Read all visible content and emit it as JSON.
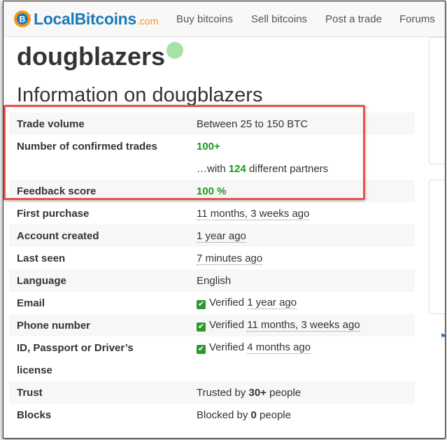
{
  "navbar": {
    "logo_text": "LocalBitcoins",
    "logo_suffix": ".com",
    "links": [
      "Buy bitcoins",
      "Sell bitcoins",
      "Post a trade",
      "Forums"
    ]
  },
  "profile": {
    "username": "dougblazers",
    "online_status_color": "#a6e2a6",
    "info_title": "Information on dougblazers"
  },
  "info_rows": {
    "trade_volume": {
      "label": "Trade volume",
      "value": "Between 25 to 150 BTC"
    },
    "confirmed_trades": {
      "label": "Number of confirmed trades",
      "value": "100+"
    },
    "partners": {
      "prefix": "…with ",
      "count": "124",
      "suffix": " different partners"
    },
    "feedback": {
      "label": "Feedback score",
      "value": "100 %"
    },
    "first_purchase": {
      "label": "First purchase",
      "value": "11 months, 3 weeks ago"
    },
    "account_created": {
      "label": "Account created",
      "value": "1 year ago"
    },
    "last_seen": {
      "label": "Last seen",
      "value": "7 minutes ago"
    },
    "language": {
      "label": "Language",
      "value": "English"
    },
    "email": {
      "label": "Email",
      "status": "Verified",
      "when": "1 year ago"
    },
    "phone": {
      "label": "Phone number",
      "status": "Verified",
      "when": "11 months, 3 weeks ago"
    },
    "id": {
      "label_line1": "ID, Passport or Driver’s",
      "label_line2": "license",
      "status": "Verified",
      "when": "4 months ago"
    },
    "trust": {
      "label": "Trust",
      "prefix": "Trusted by ",
      "count": "30+",
      "suffix": " people"
    },
    "blocks": {
      "label": "Blocks",
      "prefix": "Blocked by ",
      "count": "0",
      "suffix": " people"
    }
  },
  "colors": {
    "accent_green": "#1a9a1a",
    "highlight_border": "#e5534b",
    "brand_blue": "#1a7ab8",
    "brand_orange": "#f7931a"
  }
}
